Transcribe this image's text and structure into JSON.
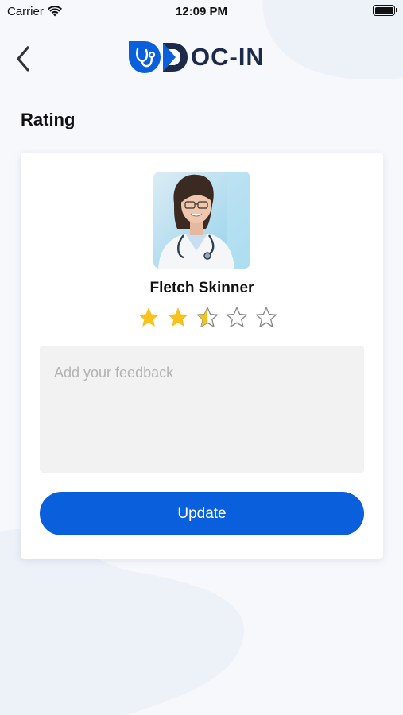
{
  "status_bar": {
    "carrier": "Carrier",
    "time": "12:09 PM"
  },
  "header": {
    "logo_text": "OC-IN",
    "back_icon": "chevron-left-icon",
    "logo_icon": "stethoscope-icon"
  },
  "page": {
    "section_title": "Rating"
  },
  "doctor": {
    "name": "Fletch Skinner",
    "avatar": "doctor-photo"
  },
  "rating": {
    "value": 2.5,
    "max": 5
  },
  "feedback": {
    "placeholder": "Add your feedback",
    "value": ""
  },
  "actions": {
    "update_label": "Update"
  },
  "colors": {
    "primary": "#0a5fdc",
    "star": "#f8c21c",
    "star_outline": "#8a8a8a",
    "logo_dark": "#1e2a4a",
    "background": "#f6f8fc"
  }
}
